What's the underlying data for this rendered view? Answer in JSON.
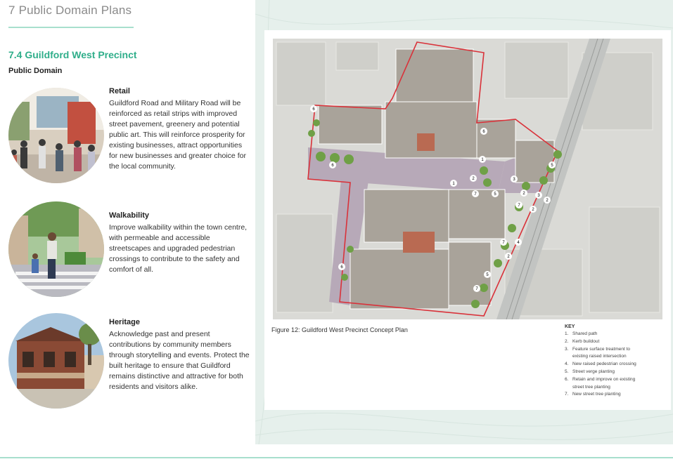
{
  "header": {
    "title": "7 Public Domain Plans"
  },
  "section": {
    "title": "7.4 Guildford West Precinct",
    "subtitle": "Public Domain"
  },
  "blocks": [
    {
      "heading": "Retail",
      "body": "Guildford Road and Military Road will be reinforced as retail strips with improved street pavement, greenery and potential public art. This will reinforce prosperity for existing businesses, attract opportunities for new businesses and greater choice for the local community."
    },
    {
      "heading": "Walkability",
      "body": "Improve walkability within the town centre, with permeable and accessible streetscapes and upgraded pedestrian crossings to contribute to the safety and comfort of all."
    },
    {
      "heading": "Heritage",
      "body": "Acknowledge past and present contributions by community members through storytelling and events. Protect the built heritage to ensure that Guildford remains distinctive and attractive for both residents and visitors alike."
    }
  ],
  "figure": {
    "caption": "Figure 12: Guildford West Precinct Concept Plan",
    "key_title": "KEY",
    "key_items": [
      {
        "num": "1.",
        "label": "Shared path"
      },
      {
        "num": "2.",
        "label": "Kerb buildout"
      },
      {
        "num": "3.",
        "label": "Feature surface treatment to"
      },
      {
        "num": "",
        "label": "existing raised intersection"
      },
      {
        "num": "4.",
        "label": "New raised pedestrian crossing"
      },
      {
        "num": "5.",
        "label": "Street verge planting"
      },
      {
        "num": "6.",
        "label": "Retain and improve on existing"
      },
      {
        "num": "",
        "label": "street tree planting"
      },
      {
        "num": "7.",
        "label": "New street tree planting"
      }
    ],
    "map_markers": [
      "6",
      "6",
      "6",
      "6",
      "1",
      "1",
      "2",
      "2",
      "2",
      "2",
      "2",
      "3",
      "3",
      "4",
      "5",
      "5",
      "5",
      "7",
      "7",
      "7",
      "7"
    ]
  },
  "colors": {
    "accent": "#2fae8a",
    "rule": "#a8dfcd",
    "boundary": "#d9323a",
    "panel": "#e6f0ec"
  }
}
